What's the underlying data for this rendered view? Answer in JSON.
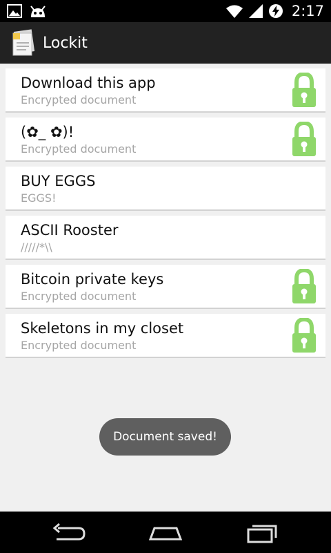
{
  "status_bar": {
    "time": "2:17",
    "icons": [
      "image-notification-icon",
      "android-notification-icon",
      "wifi-icon",
      "signal-icon",
      "battery-charging-icon"
    ]
  },
  "action_bar": {
    "title": "Lockit",
    "icon": "documents-app-icon"
  },
  "documents": [
    {
      "title": "Download this app",
      "subtitle": "Encrypted document",
      "locked": true
    },
    {
      "title": "(✿_ ✿)!",
      "subtitle": "Encrypted document",
      "locked": true
    },
    {
      "title": "BUY EGGS",
      "subtitle": "EGGS!",
      "locked": false
    },
    {
      "title": "ASCII Rooster",
      "subtitle": "/////*\\\\",
      "locked": false
    },
    {
      "title": "Bitcoin private keys",
      "subtitle": "Encrypted document",
      "locked": true
    },
    {
      "title": "Skeletons in my closet",
      "subtitle": "Encrypted document",
      "locked": true
    }
  ],
  "toast": {
    "message": "Document saved!"
  },
  "colors": {
    "lock": "#8fd76a",
    "action_bar": "#222222",
    "background": "#f0f0f0"
  },
  "nav_bar": {
    "icons": [
      "back-icon",
      "home-icon",
      "recent-apps-icon"
    ]
  }
}
